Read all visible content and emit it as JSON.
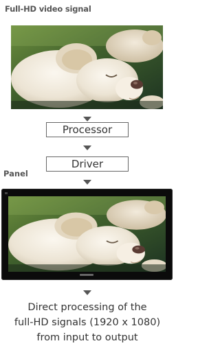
{
  "title": "Full-HD video signal",
  "steps": [
    "Processor",
    "Driver"
  ],
  "panel_label": "Panel",
  "caption": {
    "line1": "Direct processing of the",
    "line2": "full-HD signals (1920 x 1080)",
    "line3": "from input to output"
  },
  "icons": {
    "arrow": "down-triangle-icon"
  },
  "colors": {
    "text": "#333333",
    "label": "#555555",
    "tv_bezel": "#0b0b0b"
  }
}
